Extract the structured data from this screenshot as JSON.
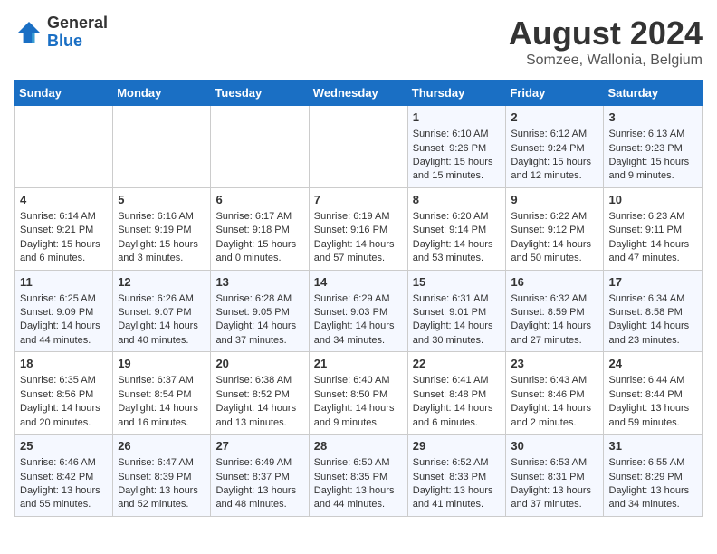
{
  "header": {
    "logo_line1": "General",
    "logo_line2": "Blue",
    "title": "August 2024",
    "subtitle": "Somzee, Wallonia, Belgium"
  },
  "weekdays": [
    "Sunday",
    "Monday",
    "Tuesday",
    "Wednesday",
    "Thursday",
    "Friday",
    "Saturday"
  ],
  "weeks": [
    [
      {
        "day": "",
        "content": ""
      },
      {
        "day": "",
        "content": ""
      },
      {
        "day": "",
        "content": ""
      },
      {
        "day": "",
        "content": ""
      },
      {
        "day": "1",
        "content": "Sunrise: 6:10 AM\nSunset: 9:26 PM\nDaylight: 15 hours\nand 15 minutes."
      },
      {
        "day": "2",
        "content": "Sunrise: 6:12 AM\nSunset: 9:24 PM\nDaylight: 15 hours\nand 12 minutes."
      },
      {
        "day": "3",
        "content": "Sunrise: 6:13 AM\nSunset: 9:23 PM\nDaylight: 15 hours\nand 9 minutes."
      }
    ],
    [
      {
        "day": "4",
        "content": "Sunrise: 6:14 AM\nSunset: 9:21 PM\nDaylight: 15 hours\nand 6 minutes."
      },
      {
        "day": "5",
        "content": "Sunrise: 6:16 AM\nSunset: 9:19 PM\nDaylight: 15 hours\nand 3 minutes."
      },
      {
        "day": "6",
        "content": "Sunrise: 6:17 AM\nSunset: 9:18 PM\nDaylight: 15 hours\nand 0 minutes."
      },
      {
        "day": "7",
        "content": "Sunrise: 6:19 AM\nSunset: 9:16 PM\nDaylight: 14 hours\nand 57 minutes."
      },
      {
        "day": "8",
        "content": "Sunrise: 6:20 AM\nSunset: 9:14 PM\nDaylight: 14 hours\nand 53 minutes."
      },
      {
        "day": "9",
        "content": "Sunrise: 6:22 AM\nSunset: 9:12 PM\nDaylight: 14 hours\nand 50 minutes."
      },
      {
        "day": "10",
        "content": "Sunrise: 6:23 AM\nSunset: 9:11 PM\nDaylight: 14 hours\nand 47 minutes."
      }
    ],
    [
      {
        "day": "11",
        "content": "Sunrise: 6:25 AM\nSunset: 9:09 PM\nDaylight: 14 hours\nand 44 minutes."
      },
      {
        "day": "12",
        "content": "Sunrise: 6:26 AM\nSunset: 9:07 PM\nDaylight: 14 hours\nand 40 minutes."
      },
      {
        "day": "13",
        "content": "Sunrise: 6:28 AM\nSunset: 9:05 PM\nDaylight: 14 hours\nand 37 minutes."
      },
      {
        "day": "14",
        "content": "Sunrise: 6:29 AM\nSunset: 9:03 PM\nDaylight: 14 hours\nand 34 minutes."
      },
      {
        "day": "15",
        "content": "Sunrise: 6:31 AM\nSunset: 9:01 PM\nDaylight: 14 hours\nand 30 minutes."
      },
      {
        "day": "16",
        "content": "Sunrise: 6:32 AM\nSunset: 8:59 PM\nDaylight: 14 hours\nand 27 minutes."
      },
      {
        "day": "17",
        "content": "Sunrise: 6:34 AM\nSunset: 8:58 PM\nDaylight: 14 hours\nand 23 minutes."
      }
    ],
    [
      {
        "day": "18",
        "content": "Sunrise: 6:35 AM\nSunset: 8:56 PM\nDaylight: 14 hours\nand 20 minutes."
      },
      {
        "day": "19",
        "content": "Sunrise: 6:37 AM\nSunset: 8:54 PM\nDaylight: 14 hours\nand 16 minutes."
      },
      {
        "day": "20",
        "content": "Sunrise: 6:38 AM\nSunset: 8:52 PM\nDaylight: 14 hours\nand 13 minutes."
      },
      {
        "day": "21",
        "content": "Sunrise: 6:40 AM\nSunset: 8:50 PM\nDaylight: 14 hours\nand 9 minutes."
      },
      {
        "day": "22",
        "content": "Sunrise: 6:41 AM\nSunset: 8:48 PM\nDaylight: 14 hours\nand 6 minutes."
      },
      {
        "day": "23",
        "content": "Sunrise: 6:43 AM\nSunset: 8:46 PM\nDaylight: 14 hours\nand 2 minutes."
      },
      {
        "day": "24",
        "content": "Sunrise: 6:44 AM\nSunset: 8:44 PM\nDaylight: 13 hours\nand 59 minutes."
      }
    ],
    [
      {
        "day": "25",
        "content": "Sunrise: 6:46 AM\nSunset: 8:42 PM\nDaylight: 13 hours\nand 55 minutes."
      },
      {
        "day": "26",
        "content": "Sunrise: 6:47 AM\nSunset: 8:39 PM\nDaylight: 13 hours\nand 52 minutes."
      },
      {
        "day": "27",
        "content": "Sunrise: 6:49 AM\nSunset: 8:37 PM\nDaylight: 13 hours\nand 48 minutes."
      },
      {
        "day": "28",
        "content": "Sunrise: 6:50 AM\nSunset: 8:35 PM\nDaylight: 13 hours\nand 44 minutes."
      },
      {
        "day": "29",
        "content": "Sunrise: 6:52 AM\nSunset: 8:33 PM\nDaylight: 13 hours\nand 41 minutes."
      },
      {
        "day": "30",
        "content": "Sunrise: 6:53 AM\nSunset: 8:31 PM\nDaylight: 13 hours\nand 37 minutes."
      },
      {
        "day": "31",
        "content": "Sunrise: 6:55 AM\nSunset: 8:29 PM\nDaylight: 13 hours\nand 34 minutes."
      }
    ]
  ]
}
